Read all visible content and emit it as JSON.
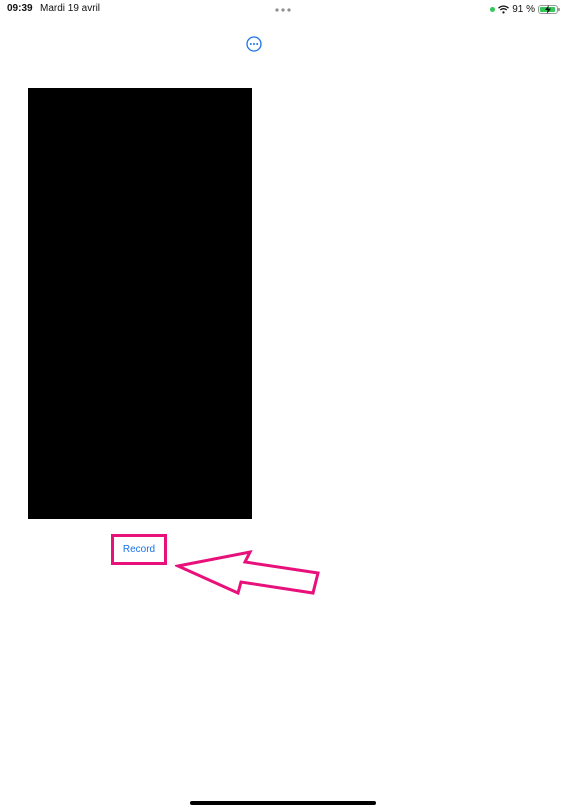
{
  "status_bar": {
    "time": "09:39",
    "date": "Mardi 19 avril",
    "battery_text": "91 %",
    "battery_level": 0.91,
    "battery_color": "#34c759",
    "privacy_indicator_color": "#34c759"
  },
  "toolbar": {
    "more_icon": "ellipsis-circle-icon",
    "accent_color": "#1a73e8"
  },
  "main": {
    "record_label": "Record",
    "annotation_color": "#e8107a"
  }
}
